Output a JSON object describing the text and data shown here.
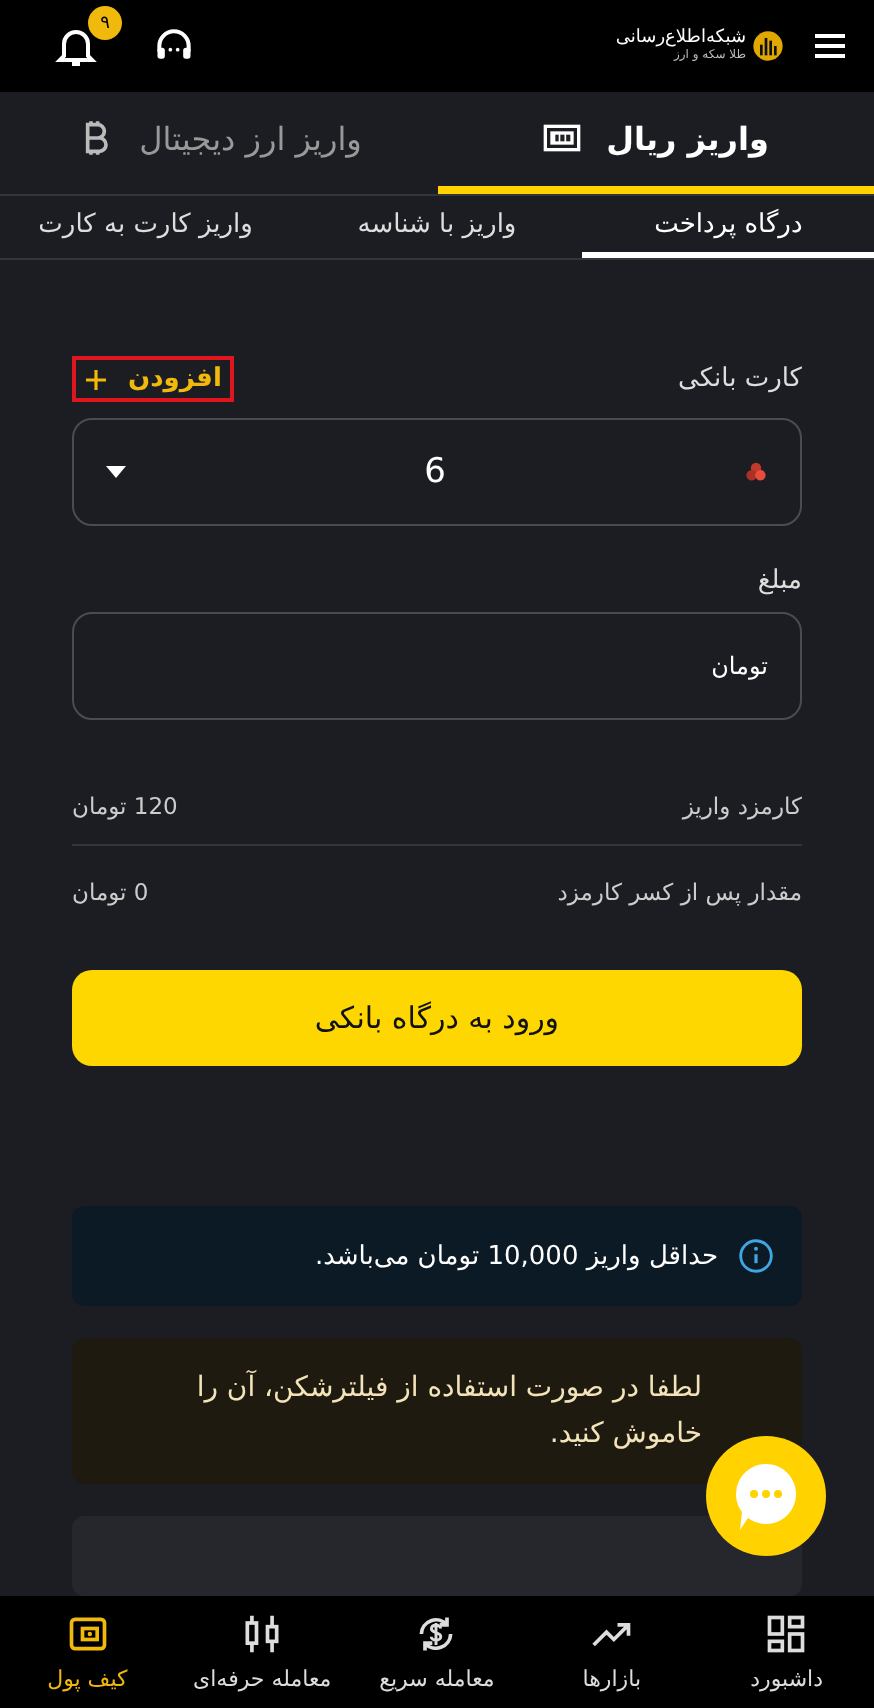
{
  "header": {
    "logo": {
      "title": "شبکه‌اطلاع‌رسانی",
      "subtitle": "طلا سکه و ارز"
    },
    "notification_count": "۹"
  },
  "deposit_tabs": [
    {
      "label": "واریز ریال",
      "selected": true
    },
    {
      "label": "واریز ارز دیجیتال",
      "selected": false
    }
  ],
  "method_tabs": [
    {
      "label": "درگاه پرداخت",
      "selected": true
    },
    {
      "label": "واریز با شناسه",
      "selected": false
    },
    {
      "label": "واریز کارت به کارت",
      "selected": false
    }
  ],
  "form": {
    "card_label": "کارت بانکی",
    "add_button": {
      "label": "افزودن",
      "highlighted": true
    },
    "card_select": {
      "value": "6"
    },
    "amount_label": "مبلغ",
    "amount_unit": "تومان"
  },
  "fees": [
    {
      "label": "کارمزد واریز",
      "value": "120 تومان"
    },
    {
      "label": "مقدار پس از کسر کارمزد",
      "value": "0 تومان"
    }
  ],
  "submit_button": "ورود به درگاه بانکی",
  "notices": [
    {
      "kind": "info",
      "text": "حداقل واریز 10,000 تومان می‌باشد."
    },
    {
      "kind": "warning",
      "text": "لطفا در صورت استفاده از فیلترشکن، آن را خاموش کنید."
    }
  ],
  "bottom_nav": [
    {
      "label": "داشبورد",
      "selected": false
    },
    {
      "label": "بازارها",
      "selected": false
    },
    {
      "label": "معامله سریع",
      "selected": false
    },
    {
      "label": "معامله حرفه‌ای",
      "selected": false
    },
    {
      "label": "کیف پول",
      "selected": true
    }
  ]
}
